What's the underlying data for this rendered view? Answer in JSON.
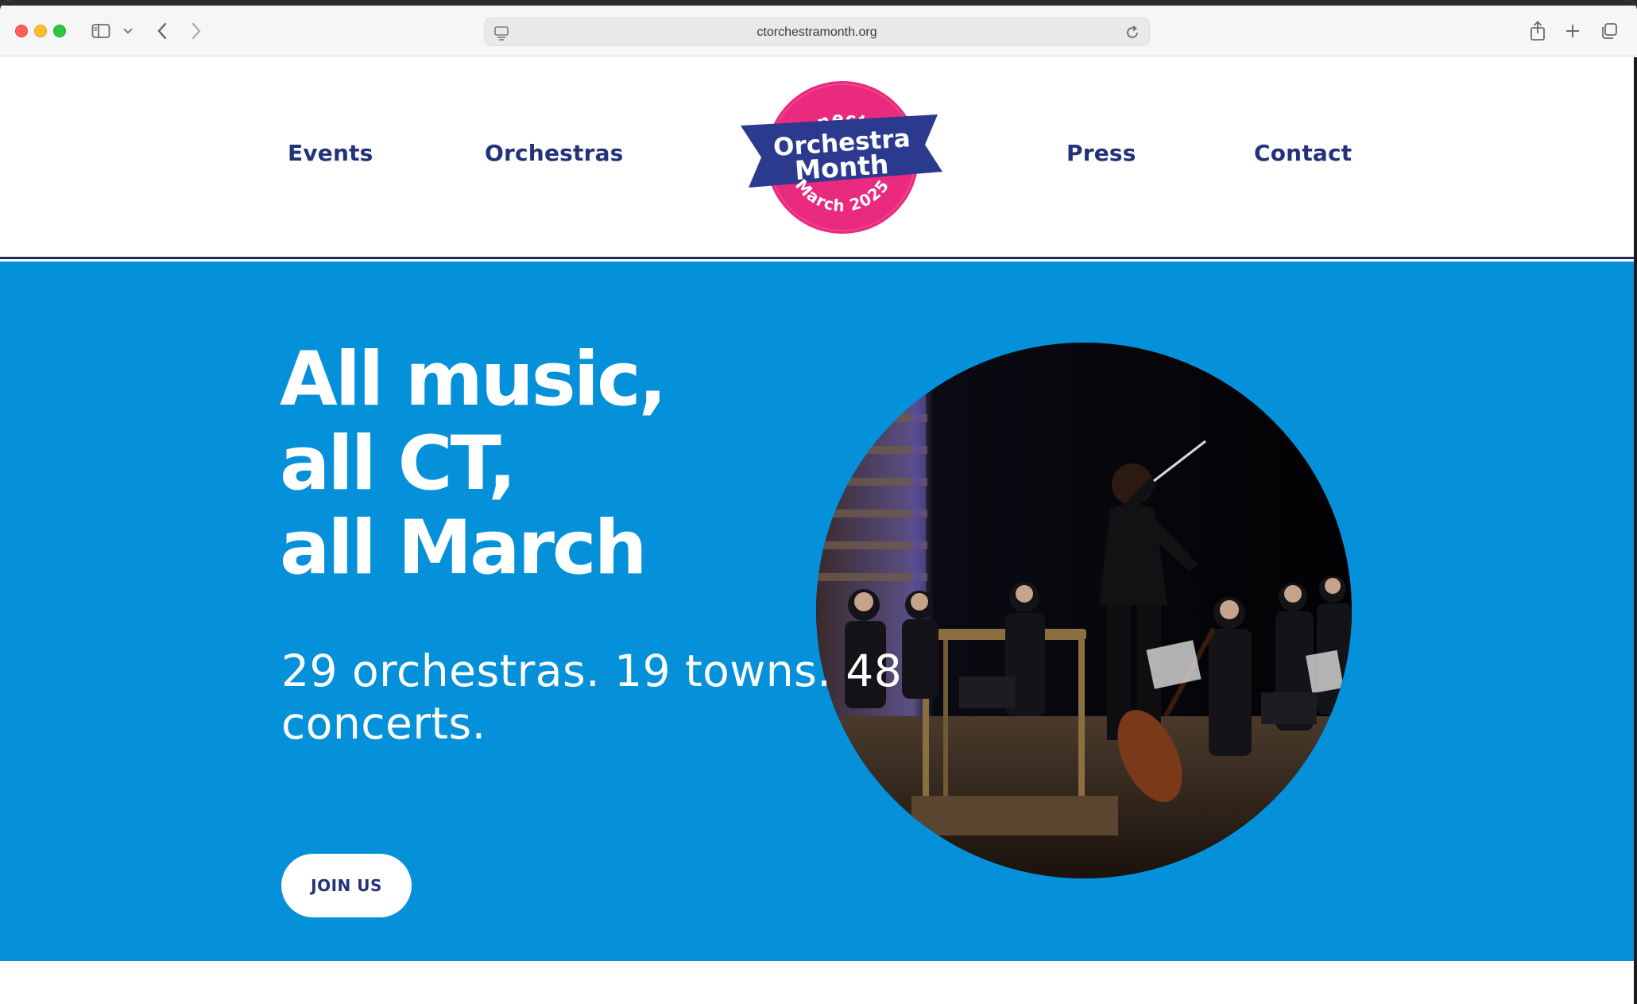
{
  "browser": {
    "url": "ctorchestramonth.org",
    "icons": {
      "sidebar": "sidebar-icon",
      "back": "chevron-left-icon",
      "forward": "chevron-right-icon",
      "reload": "reload-icon",
      "share": "share-icon",
      "new_tab": "plus-icon",
      "tab_overview": "tabs-icon"
    }
  },
  "nav": {
    "events": "Events",
    "orchestras": "Orchestras",
    "press": "Press",
    "contact": "Contact"
  },
  "logo": {
    "top_arc": "Connecticut",
    "line1": "Orchestra",
    "line2": "Month",
    "bottom_arc": "March 2025"
  },
  "hero": {
    "title_lines": [
      "All music,",
      "all CT,",
      "all March"
    ],
    "stats": "29 orchestras. 19 towns. 48 concerts.",
    "cta": "JOIN US",
    "photo_alt": "orchestra-concert-photo"
  },
  "colors": {
    "navy": "#24327a",
    "hero_blue": "#0591da",
    "logo_pink": "#ea2a7e",
    "logo_ribbon": "#2b3a8f"
  }
}
